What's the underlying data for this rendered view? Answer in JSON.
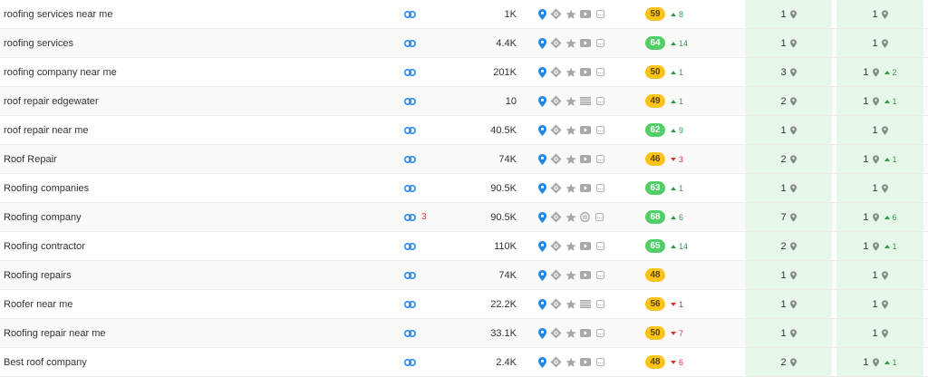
{
  "colors": {
    "pin_blue": "#1e88e5",
    "icon_grey": "#a8a8a8",
    "kd_yellow": "#fcc419",
    "kd_green": "#51cf66",
    "up": "#2f9e44",
    "down": "#e03131",
    "pos_bg": "#e7f8ea"
  },
  "icons": {
    "link": "link-icon",
    "map_pin": "map-pin-icon",
    "local_pack": "local-pack-icon",
    "star": "star-icon",
    "video": "video-icon",
    "list": "list-icon",
    "image": "image-icon",
    "more": "more-icon"
  },
  "rows": [
    {
      "keyword": "roofing services near me",
      "links": "",
      "volume": "1K",
      "feature": "video",
      "kd": "59",
      "kd_color": "y",
      "trend": "8",
      "trend_dir": "up",
      "pos1": "1",
      "pos2": "1",
      "pos2_trend": "",
      "pos2_dir": ""
    },
    {
      "keyword": "roofing services",
      "links": "",
      "volume": "4.4K",
      "feature": "video",
      "kd": "64",
      "kd_color": "g",
      "trend": "14",
      "trend_dir": "up",
      "pos1": "1",
      "pos2": "1",
      "pos2_trend": "",
      "pos2_dir": ""
    },
    {
      "keyword": "roofing company near me",
      "links": "",
      "volume": "201K",
      "feature": "video",
      "kd": "50",
      "kd_color": "y",
      "trend": "1",
      "trend_dir": "up",
      "pos1": "3",
      "pos2": "1",
      "pos2_trend": "2",
      "pos2_dir": "up"
    },
    {
      "keyword": "roof repair edgewater",
      "links": "",
      "volume": "10",
      "feature": "list",
      "kd": "49",
      "kd_color": "y",
      "trend": "1",
      "trend_dir": "up",
      "pos1": "2",
      "pos2": "1",
      "pos2_trend": "1",
      "pos2_dir": "up"
    },
    {
      "keyword": "roof repair near me",
      "links": "",
      "volume": "40.5K",
      "feature": "video",
      "kd": "62",
      "kd_color": "g",
      "trend": "9",
      "trend_dir": "up",
      "pos1": "1",
      "pos2": "1",
      "pos2_trend": "",
      "pos2_dir": ""
    },
    {
      "keyword": "Roof Repair",
      "links": "",
      "volume": "74K",
      "feature": "video",
      "kd": "46",
      "kd_color": "y",
      "trend": "3",
      "trend_dir": "down",
      "pos1": "2",
      "pos2": "1",
      "pos2_trend": "1",
      "pos2_dir": "up"
    },
    {
      "keyword": "Roofing companies",
      "links": "",
      "volume": "90.5K",
      "feature": "video",
      "kd": "63",
      "kd_color": "g",
      "trend": "1",
      "trend_dir": "up",
      "pos1": "1",
      "pos2": "1",
      "pos2_trend": "",
      "pos2_dir": ""
    },
    {
      "keyword": "Roofing company",
      "links": "3",
      "volume": "90.5K",
      "feature": "image",
      "kd": "68",
      "kd_color": "g",
      "trend": "6",
      "trend_dir": "up",
      "pos1": "7",
      "pos2": "1",
      "pos2_trend": "6",
      "pos2_dir": "up"
    },
    {
      "keyword": "Roofing contractor",
      "links": "",
      "volume": "110K",
      "feature": "video",
      "kd": "65",
      "kd_color": "g",
      "trend": "14",
      "trend_dir": "up",
      "pos1": "2",
      "pos2": "1",
      "pos2_trend": "1",
      "pos2_dir": "up"
    },
    {
      "keyword": "Roofing repairs",
      "links": "",
      "volume": "74K",
      "feature": "video",
      "kd": "48",
      "kd_color": "y",
      "trend": "",
      "trend_dir": "",
      "pos1": "1",
      "pos2": "1",
      "pos2_trend": "",
      "pos2_dir": ""
    },
    {
      "keyword": "Roofer near me",
      "links": "",
      "volume": "22.2K",
      "feature": "list",
      "kd": "56",
      "kd_color": "y",
      "trend": "1",
      "trend_dir": "down",
      "pos1": "1",
      "pos2": "1",
      "pos2_trend": "",
      "pos2_dir": ""
    },
    {
      "keyword": "Roofing repair near me",
      "links": "",
      "volume": "33.1K",
      "feature": "video",
      "kd": "50",
      "kd_color": "y",
      "trend": "7",
      "trend_dir": "down",
      "pos1": "1",
      "pos2": "1",
      "pos2_trend": "",
      "pos2_dir": ""
    },
    {
      "keyword": "Best roof company",
      "links": "",
      "volume": "2.4K",
      "feature": "video",
      "kd": "48",
      "kd_color": "y",
      "trend": "6",
      "trend_dir": "down",
      "pos1": "2",
      "pos2": "1",
      "pos2_trend": "1",
      "pos2_dir": "up"
    }
  ]
}
